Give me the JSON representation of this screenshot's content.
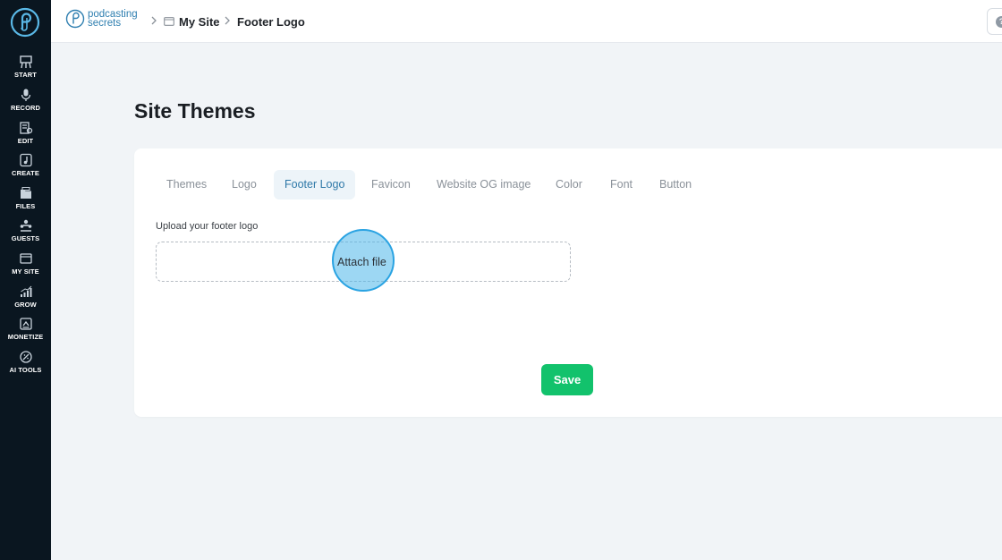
{
  "sidebar": {
    "items": [
      {
        "label": "START",
        "icon": "easel-icon"
      },
      {
        "label": "RECORD",
        "icon": "microphone-icon"
      },
      {
        "label": "EDIT",
        "icon": "edit-icon"
      },
      {
        "label": "CREATE",
        "icon": "music-note-icon"
      },
      {
        "label": "FILES",
        "icon": "files-icon"
      },
      {
        "label": "GUESTS",
        "icon": "guests-icon"
      },
      {
        "label": "MY SITE",
        "icon": "browser-window-icon"
      },
      {
        "label": "GROW",
        "icon": "growth-chart-icon"
      },
      {
        "label": "MONETIZE",
        "icon": "monetize-icon"
      },
      {
        "label": "AI TOOLS",
        "icon": "ai-tools-icon"
      }
    ]
  },
  "header": {
    "brand_line1": "podcasting",
    "brand_line2": "secrets",
    "breadcrumb": [
      "My Site",
      "Footer Logo"
    ],
    "help_symbol": "?"
  },
  "page": {
    "title": "Site Themes",
    "tabs": [
      "Themes",
      "Logo",
      "Footer Logo",
      "Favicon",
      "Website OG image",
      "Color",
      "Font",
      "Button"
    ],
    "active_tab": "Footer Logo",
    "upload_label": "Upload your footer logo",
    "attach_label": "Attach file",
    "save_label": "Save"
  },
  "colors": {
    "sidebar_bg": "#0a1620",
    "accent": "#2e78a8",
    "save": "#12c26c",
    "highlight": "#4db6ea"
  }
}
